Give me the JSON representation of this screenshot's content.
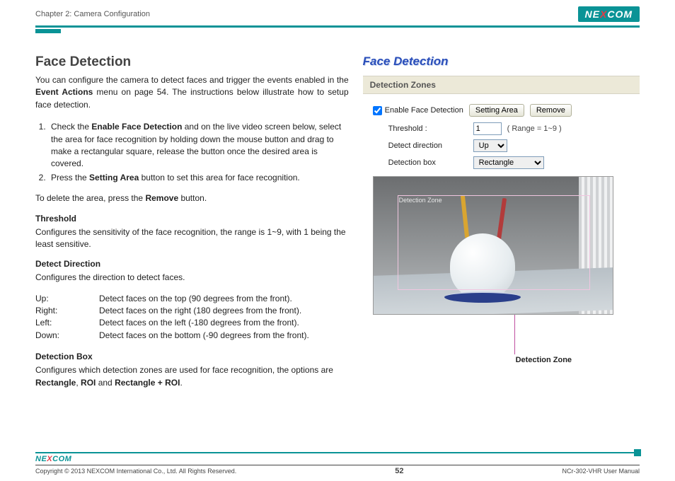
{
  "header": {
    "chapter": "Chapter 2: Camera Configuration",
    "logo_pre": "NE",
    "logo_x": "X",
    "logo_post": "COM"
  },
  "doc": {
    "h1": "Face Detection",
    "intro_1": "You can configure the camera to detect faces and trigger the events enabled in the ",
    "intro_b1": "Event Actions",
    "intro_2": " menu on page 54. The instructions below illustrate how to setup face detection.",
    "step1_a": "Check the ",
    "step1_b": "Enable Face Detection",
    "step1_c": " and on the live video screen below, select the area for face recognition by holding down the mouse button and drag to make a rectangular square, release the button once the desired area is covered.",
    "step2_a": "Press the ",
    "step2_b": "Setting Area",
    "step2_c": " button to set this area for face recognition.",
    "delete_a": "To delete the area, press the ",
    "delete_b": "Remove",
    "delete_c": " button.",
    "threshold_h": "Threshold",
    "threshold_p": "Configures the sensitivity of the face recognition, the range is 1~9, with 1 being the least sensitive.",
    "detectdir_h": "Detect Direction",
    "detectdir_p": "Configures the direction to detect faces.",
    "dirs": {
      "up_l": "Up:",
      "up_v": "Detect faces on the top (90 degrees from the front).",
      "right_l": "Right:",
      "right_v": "Detect faces on the right (180 degrees from the front).",
      "left_l": "Left:",
      "left_v": "Detect faces on the left (-180 degrees from the front).",
      "down_l": "Down:",
      "down_v": "Detect faces on the bottom (-90 degrees from the front)."
    },
    "detbox_h": "Detection Box",
    "detbox_a": "Configures which detection zones are used for face recognition, the options are ",
    "detbox_b1": "Rectangle",
    "detbox_c1": ", ",
    "detbox_b2": "ROI",
    "detbox_c2": " and ",
    "detbox_b3": "Rectangle + ROI",
    "detbox_c3": "."
  },
  "app": {
    "title": "Face Detection",
    "zones_header": "Detection Zones",
    "enable_label": "Enable Face Detection",
    "setting_btn": "Setting Area",
    "remove_btn": "Remove",
    "threshold_lbl": "Threshold :",
    "threshold_val": "1",
    "threshold_range": "( Range = 1~9 )",
    "detectdir_lbl": "Detect direction",
    "detectdir_val": "Up",
    "detbox_lbl": "Detection box",
    "detbox_val": "Rectangle",
    "overlay_text": "Detection Zone",
    "callout_text": "Detection Zone"
  },
  "footer": {
    "logo_pre": "NE",
    "logo_x": "X",
    "logo_post": "COM",
    "copyright": "Copyright © 2013 NEXCOM International Co., Ltd. All Rights Reserved.",
    "page": "52",
    "manual": "NCr-302-VHR User Manual"
  }
}
